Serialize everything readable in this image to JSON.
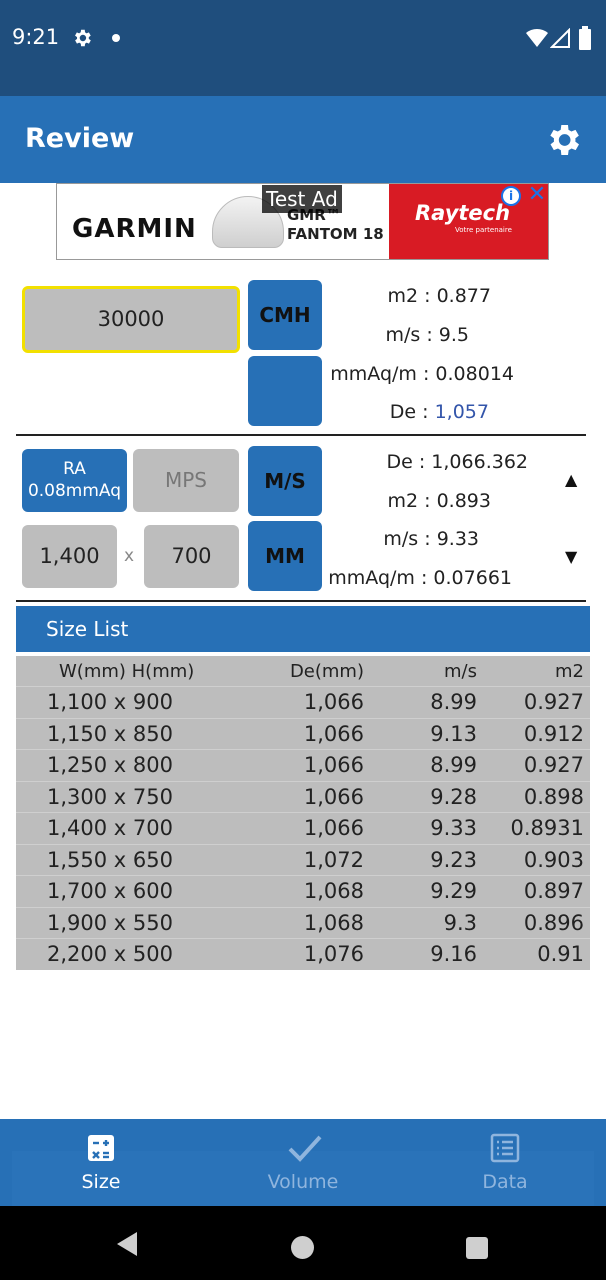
{
  "status_bar": {
    "time": "9:21"
  },
  "app_bar": {
    "title": "Review"
  },
  "ad": {
    "label": "Test Ad",
    "left_brand": "GARMIN",
    "product_line1": "GMR™",
    "product_line2": "FANTOM 18",
    "right_brand": "Raytech",
    "right_sub": "Votre partenaire"
  },
  "volume": {
    "value": "30000",
    "unit_button": "CMH"
  },
  "volume_results": {
    "area_label": "m2 : ",
    "area_value": "0.877",
    "velocity_label": "m/s : ",
    "velocity_value": "9.5",
    "friction_label": "mmAq/m : ",
    "friction_value": "0.08014",
    "de_label": "De : ",
    "de_value": "1,057"
  },
  "method": {
    "ra_line1": "RA",
    "ra_line2": "0.08mmAq",
    "mps": "MPS",
    "velocity_unit": "M/S",
    "size_unit": "MM"
  },
  "dimensions": {
    "width": "1,400",
    "times": "x",
    "height": "700"
  },
  "size_results": {
    "de_label": "De : ",
    "de_value": "1,066.362",
    "area_label": "m2 : ",
    "area_value": "0.893",
    "velocity_label": "m/s : ",
    "velocity_value": "9.33",
    "friction_label": "mmAq/m : ",
    "friction_value": "0.07661"
  },
  "size_list": {
    "title": "Size List",
    "headers": [
      "W(mm)  H(mm)",
      "De(mm)",
      "m/s",
      "m2"
    ],
    "rows": [
      [
        "1,100 x 900",
        "1,066",
        "8.99",
        "0.927"
      ],
      [
        "1,150 x 850",
        "1,066",
        "9.13",
        "0.912"
      ],
      [
        "1,250 x 800",
        "1,066",
        "8.99",
        "0.927"
      ],
      [
        "1,300 x 750",
        "1,066",
        "9.28",
        "0.898"
      ],
      [
        "1,400 x 700",
        "1,066",
        "9.33",
        "0.8931"
      ],
      [
        "1,550 x 650",
        "1,072",
        "9.23",
        "0.903"
      ],
      [
        "1,700 x 600",
        "1,068",
        "9.29",
        "0.897"
      ],
      [
        "1,900 x 550",
        "1,068",
        "9.3",
        "0.896"
      ],
      [
        "2,200 x 500",
        "1,076",
        "9.16",
        "0.91"
      ]
    ]
  },
  "bottom_nav": {
    "size": "Size",
    "volume": "Volume",
    "data": "Data"
  },
  "colors": {
    "primary": "#2770b6",
    "status": "#1f4e7d",
    "input": "#bdbdbd",
    "focus": "#f2e000"
  }
}
